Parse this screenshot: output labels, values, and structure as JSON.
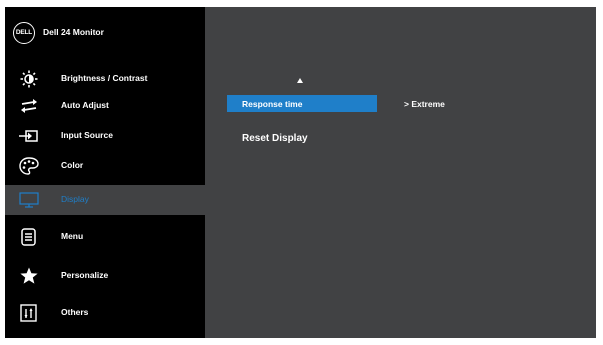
{
  "brand": {
    "logo": "DELL",
    "title": "Dell 24 Monitor"
  },
  "menu": [
    {
      "label": "Brightness / Contrast",
      "icon": "brightness-icon",
      "active": false
    },
    {
      "label": "Auto Adjust",
      "icon": "auto-adjust-icon",
      "active": false
    },
    {
      "label": "Input Source",
      "icon": "input-source-icon",
      "active": false
    },
    {
      "label": "Color",
      "icon": "color-palette-icon",
      "active": false
    },
    {
      "label": "Display",
      "icon": "display-icon",
      "active": true
    },
    {
      "label": "Menu",
      "icon": "menu-icon",
      "active": false
    },
    {
      "label": "Personalize",
      "icon": "star-icon",
      "active": false
    },
    {
      "label": "Others",
      "icon": "others-icon",
      "active": false
    }
  ],
  "submenu": {
    "items": [
      {
        "label": "Response time",
        "selected": true,
        "value": "> Extreme"
      },
      {
        "label": "Reset Display",
        "selected": false
      }
    ]
  },
  "colors": {
    "accent": "#1f7fc9",
    "sidebar": "#000000",
    "panel": "#414244"
  }
}
